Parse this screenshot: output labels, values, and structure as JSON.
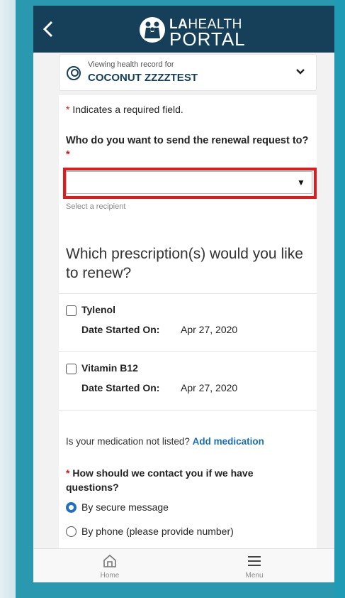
{
  "header": {
    "logo_line1_bold": "LA",
    "logo_line1_rest": "HEALTH",
    "logo_line2": "PORTAL",
    "back_icon": "chevron-left-icon"
  },
  "patient": {
    "viewing_label": "Viewing health record for",
    "name": "COCONUT ZZZZTEST"
  },
  "form": {
    "required_note": "Indicates a required field.",
    "recipient_question": "Who do you want to send the renewal request to?",
    "recipient_value": "",
    "recipient_hint": "Select a recipient",
    "prescriptions_heading": "Which prescription(s) would you like to renew?",
    "medications": [
      {
        "name": "Tylenol",
        "date_label": "Date Started On:",
        "date": "Apr 27, 2020",
        "checked": false
      },
      {
        "name": "Vitamin B12",
        "date_label": "Date Started On:",
        "date": "Apr 27, 2020",
        "checked": false
      }
    ],
    "not_listed_text": "Is your medication not listed?",
    "add_medication_link": "Add medication",
    "contact_question": "How should we contact you if we have questions?",
    "contact_options": [
      {
        "label": "By secure message",
        "selected": true
      },
      {
        "label": "By phone (please provide number)",
        "selected": false
      }
    ]
  },
  "tabbar": {
    "home_label": "Home",
    "menu_label": "Menu"
  },
  "colors": {
    "navbar": "#16405a",
    "accent_link": "#1b6fb0",
    "required_star": "#dd1111",
    "highlight_box": "#e01b1b",
    "radio_selected": "#1f6fc5"
  }
}
